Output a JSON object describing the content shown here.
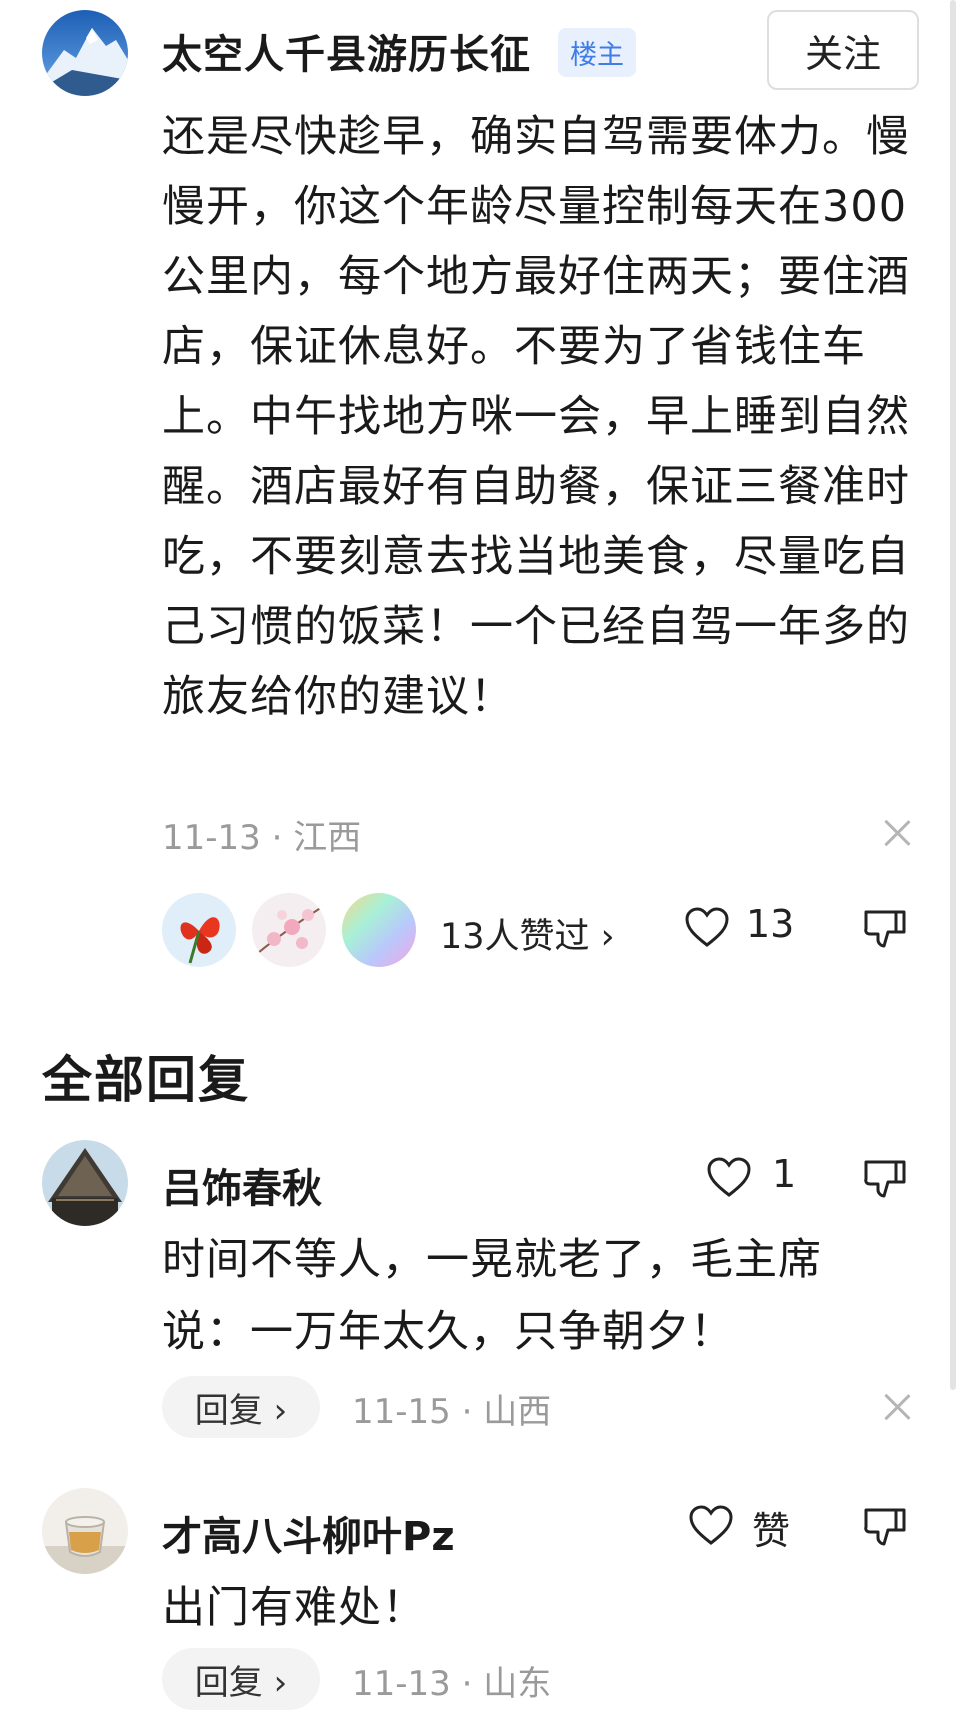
{
  "post": {
    "author": "太空人千县游历长征",
    "badge": "楼主",
    "follow_label": "关注",
    "content": "还是尽快趁早，确实自驾需要体力。慢慢开，你这个年龄尽量控制每天在300公里内，每个地方最好住两天；要住酒店，保证休息好。不要为了省钱住车上。中午找地方咪一会，早上睡到自然醒。酒店最好有自助餐，保证三餐准时吃，不要刻意去找当地美食，尽量吃自己习惯的饭菜！一个已经自驾一年多的旅友给你的建议！",
    "meta": "11-13 · 江西",
    "likers_text": "13人赞过 ›",
    "like_count": "13"
  },
  "section_title": "全部回复",
  "replies": [
    {
      "author": "吕饰春秋",
      "content": "时间不等人，一晃就老了，毛主席说：一万年太久，只争朝夕！",
      "reply_label": "回复 ›",
      "meta": "11-15 · 山西",
      "like_label": "1"
    },
    {
      "author": "才高八斗柳叶Pz",
      "content": "出门有难处！",
      "reply_label": "回复 ›",
      "meta": "11-13 · 山东",
      "like_label": "赞"
    }
  ],
  "icons": {
    "like": "heart-outline-icon",
    "dislike": "thumbs-down-outline-icon",
    "close": "close-icon"
  }
}
